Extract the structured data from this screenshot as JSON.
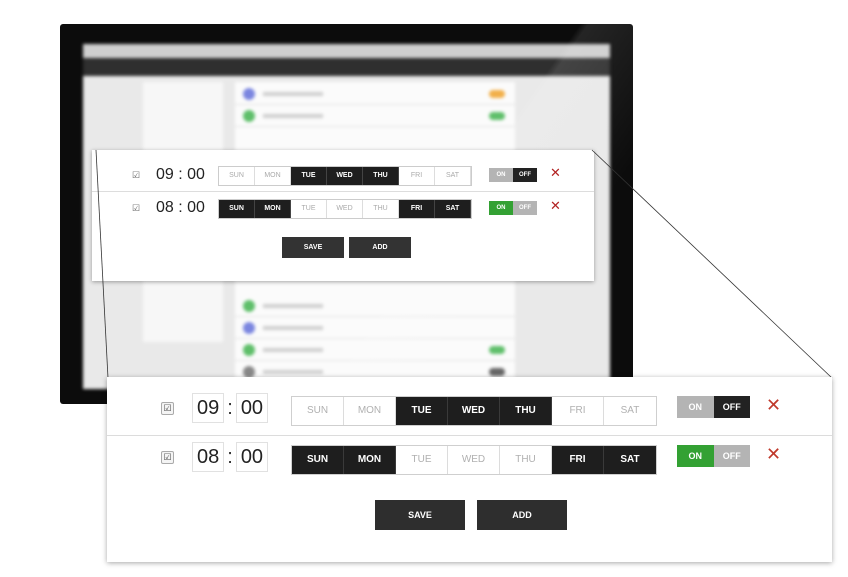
{
  "schedules": [
    {
      "checked": true,
      "check_glyph": "☑",
      "hours": "09",
      "minutes": "00",
      "separator": ":",
      "days": [
        {
          "label": "SUN",
          "active": false
        },
        {
          "label": "MON",
          "active": false
        },
        {
          "label": "TUE",
          "active": true
        },
        {
          "label": "WED",
          "active": true
        },
        {
          "label": "THU",
          "active": true
        },
        {
          "label": "FRI",
          "active": false
        },
        {
          "label": "SAT",
          "active": false
        }
      ],
      "toggle": {
        "on_label": "ON",
        "off_label": "OFF",
        "state": "off"
      },
      "remove_glyph": "✕"
    },
    {
      "checked": true,
      "check_glyph": "☑",
      "hours": "08",
      "minutes": "00",
      "separator": ":",
      "days": [
        {
          "label": "SUN",
          "active": true
        },
        {
          "label": "MON",
          "active": true
        },
        {
          "label": "TUE",
          "active": false
        },
        {
          "label": "WED",
          "active": false
        },
        {
          "label": "THU",
          "active": false
        },
        {
          "label": "FRI",
          "active": true
        },
        {
          "label": "SAT",
          "active": true
        }
      ],
      "toggle": {
        "on_label": "ON",
        "off_label": "OFF",
        "state": "on"
      },
      "remove_glyph": "✕"
    }
  ],
  "actions": {
    "save_label": "SAVE",
    "add_label": "ADD"
  },
  "colors": {
    "toggle_on_active": "#33a133",
    "toggle_off_active": "#222222",
    "toggle_inactive": "#b4b4b4",
    "remove": "#c0392b",
    "day_active": "#1e1e1e"
  }
}
